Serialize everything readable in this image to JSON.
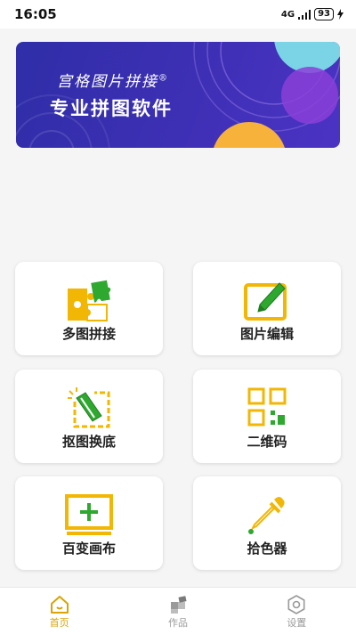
{
  "status": {
    "time": "16:05",
    "network": "4G",
    "battery": "93"
  },
  "banner": {
    "title": "宫格图片拼接",
    "registered": "®",
    "subtitle": "专业拼图软件"
  },
  "features": [
    {
      "label": "多图拼接",
      "icon": "puzzle-icon"
    },
    {
      "label": "图片编辑",
      "icon": "edit-icon"
    },
    {
      "label": "抠图换底",
      "icon": "cutout-icon"
    },
    {
      "label": "二维码",
      "icon": "qrcode-icon"
    },
    {
      "label": "百变画布",
      "icon": "canvas-icon"
    },
    {
      "label": "拾色器",
      "icon": "eyedropper-icon"
    }
  ],
  "tabs": [
    {
      "label": "首页",
      "icon": "home-icon",
      "active": true
    },
    {
      "label": "作品",
      "icon": "works-icon",
      "active": false
    },
    {
      "label": "设置",
      "icon": "settings-icon",
      "active": false
    }
  ],
  "colors": {
    "accent": "#f2b705",
    "green": "#2ea82e",
    "banner": "#3b2fb2",
    "tabActive": "#d9a404",
    "tabInactive": "#9a9a9a"
  }
}
